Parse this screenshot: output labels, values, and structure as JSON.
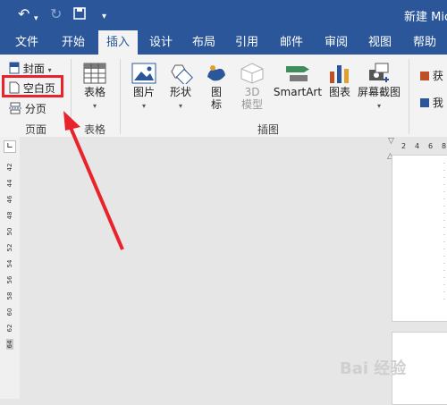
{
  "titlebar": {
    "doc_title": "新建 Mic"
  },
  "tabs": [
    "文件",
    "开始",
    "插入",
    "设计",
    "布局",
    "引用",
    "邮件",
    "审阅",
    "视图",
    "帮助"
  ],
  "active_tab": "插入",
  "ribbon": {
    "pages": {
      "cover": "封面",
      "blank_page": "空白页",
      "page_break": "分页",
      "group": "页面"
    },
    "tables": {
      "table": "表格",
      "group": "表格"
    },
    "illustrations": {
      "pictures": "图片",
      "shapes": "形状",
      "icons_line1": "图",
      "icons_line2": "标",
      "models_line1": "3D",
      "models_line2": "模型",
      "smartart": "SmartArt",
      "chart": "图表",
      "screenshot": "屏幕截图",
      "group": "插图"
    },
    "addins": {
      "get": "获",
      "my": "我"
    }
  },
  "ruler_v_ticks": [
    "42",
    "44",
    "46",
    "48",
    "50",
    "52",
    "54",
    "56",
    "58",
    "60",
    "62",
    "64"
  ],
  "ruler_h_ticks": [
    "2",
    "4",
    "6",
    "8"
  ],
  "watermark": "Bai 经验",
  "colors": {
    "accent": "#2b579a",
    "highlight": "#e8232c"
  }
}
